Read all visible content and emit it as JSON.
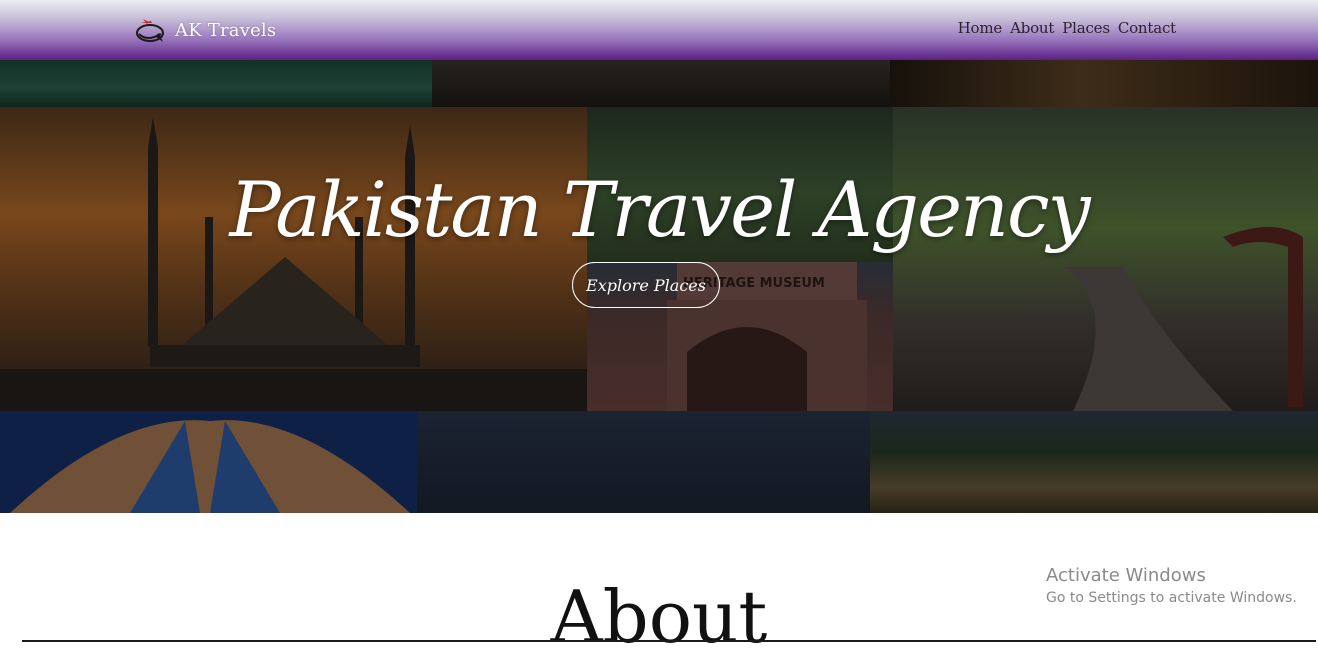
{
  "brand": {
    "name": "AK Travels",
    "logo_icon": "plane-globe-logo-icon"
  },
  "nav": {
    "items": [
      "Home",
      "About",
      "Places",
      "Contact"
    ]
  },
  "hero": {
    "title": "Pakistan Travel Agency",
    "button_label": "Explore Places",
    "photo_subjects": [
      "river-swimmers-photo",
      "rocks-photo",
      "boat-photo",
      "faisal-mosque-photo",
      "park-trees-photo",
      "heritage-museum-photo",
      "garden-path-photo",
      "pakistan-monument-photo",
      "night-sky-photo",
      "city-lights-photo"
    ],
    "museum_sign": "HERITAGE MUSEUM"
  },
  "about": {
    "heading": "About"
  },
  "windows_watermark": {
    "title": "Activate Windows",
    "subtitle": "Go to Settings to activate Windows."
  },
  "colors": {
    "nav_gradient_end": "#5c1f86",
    "nav_text": "#2a2333",
    "hero_text": "#ffffff"
  }
}
